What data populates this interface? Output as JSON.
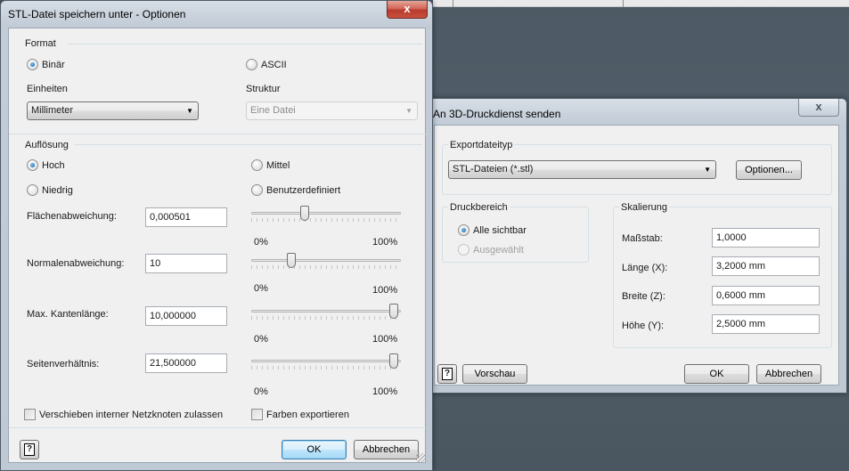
{
  "dialog_main": {
    "title": "STL-Datei speichern unter - Optionen",
    "close_label": "x",
    "format": {
      "group_label": "Format",
      "binary_label": "Binär",
      "ascii_label": "ASCII",
      "units_label": "Einheiten",
      "units_value": "Millimeter",
      "structure_label": "Struktur",
      "structure_value": "Eine Datei"
    },
    "resolution": {
      "group_label": "Auflösung",
      "high_label": "Hoch",
      "medium_label": "Mittel",
      "low_label": "Niedrig",
      "custom_label": "Benutzerdefiniert",
      "rows": [
        {
          "label": "Flächenabweichung:",
          "value": "0,000501",
          "slider_pct": 0.35,
          "min_label": "0%",
          "max_label": "100%"
        },
        {
          "label": "Normalenabweichung:",
          "value": "10",
          "slider_pct": 0.25,
          "min_label": "0%",
          "max_label": "100%"
        },
        {
          "label": "Max. Kantenlänge:",
          "value": "10,000000",
          "slider_pct": 0.98,
          "min_label": "0%",
          "max_label": "100%"
        },
        {
          "label": "Seitenverhältnis:",
          "value": "21,500000",
          "slider_pct": 0.98,
          "min_label": "0%",
          "max_label": "100%"
        }
      ]
    },
    "move_nodes_label": "Verschieben interner Netzknoten zulassen",
    "export_colors_label": "Farben exportieren",
    "help_label": "?",
    "ok_label": "OK",
    "cancel_label": "Abbrechen"
  },
  "dialog_send": {
    "title": "An 3D-Druckdienst senden",
    "close_label": "x",
    "export_type_group": "Exportdateityp",
    "export_type_value": "STL-Dateien (*.stl)",
    "options_label": "Optionen...",
    "print_area_group": "Druckbereich",
    "all_visible_label": "Alle sichtbar",
    "selected_label": "Ausgewählt",
    "scaling_group": "Skalierung",
    "scale_label": "Maßstab:",
    "scale_value": "1,0000",
    "length_label": "Länge (X):",
    "length_value": "3,2000 mm",
    "width_label": "Breite (Z):",
    "width_value": "0,6000 mm",
    "height_label": "Höhe (Y):",
    "height_value": "2,5000 mm",
    "help_label": "?",
    "preview_label": "Vorschau",
    "ok_label": "OK",
    "cancel_label": "Abbrechen"
  }
}
